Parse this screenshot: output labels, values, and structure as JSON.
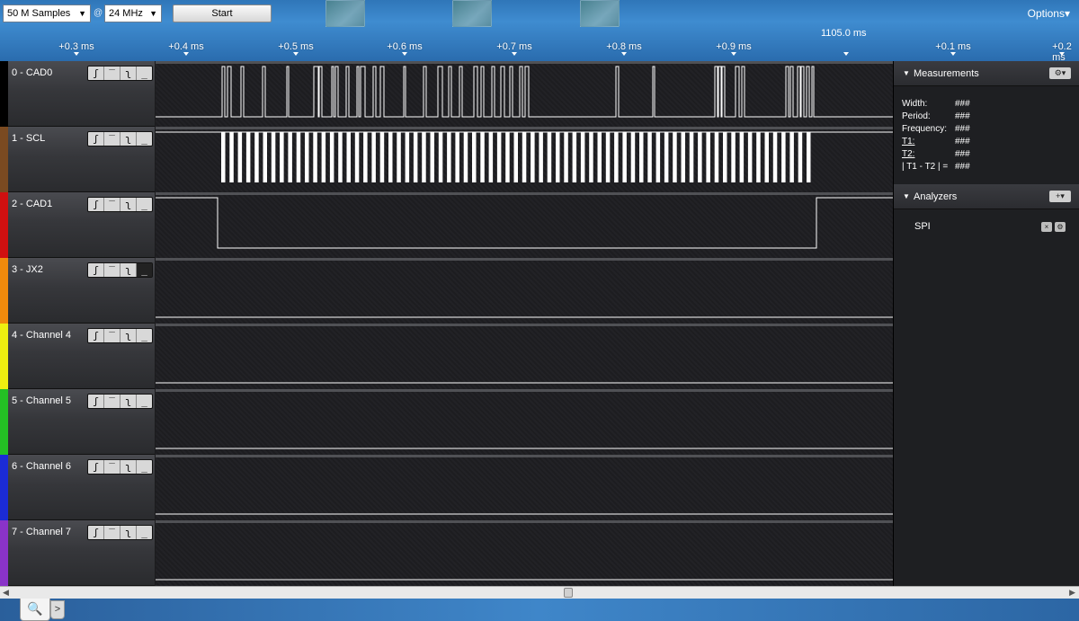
{
  "toolbar": {
    "samples_value": "50 M Samples",
    "at_sign": "@",
    "rate_value": "24 MHz",
    "start_label": "Start",
    "options_label": "Options▾"
  },
  "timeline": {
    "ticks": [
      "+0.3 ms",
      "+0.4 ms",
      "+0.5 ms",
      "+0.6 ms",
      "+0.7 ms",
      "+0.8 ms",
      "+0.9 ms",
      "+0.1 ms",
      "+0.2 ms"
    ],
    "cursor_time": "1105.0 ms"
  },
  "channels": [
    {
      "name": "0 - CAD0",
      "color": "#000000"
    },
    {
      "name": "1 - SCL",
      "color": "#7a4a21"
    },
    {
      "name": "2 - CAD1",
      "color": "#d01010"
    },
    {
      "name": "3 - JX2",
      "color": "#f08a0c"
    },
    {
      "name": "4 - Channel 4",
      "color": "#eeee10"
    },
    {
      "name": "5 - Channel 5",
      "color": "#24c024"
    },
    {
      "name": "6 - Channel 6",
      "color": "#1b2bd6"
    },
    {
      "name": "7 - Channel 7",
      "color": "#8a33c8"
    }
  ],
  "trigger_buttons": [
    "ʃ",
    "‾",
    "ʅ",
    "_"
  ],
  "measurements": {
    "title": "Measurements",
    "rows": [
      {
        "label": "Width:",
        "value": "###"
      },
      {
        "label": "Period:",
        "value": "###"
      },
      {
        "label": "Frequency:",
        "value": "###"
      },
      {
        "label": "T1:",
        "value": "###"
      },
      {
        "label": "T2:",
        "value": "###"
      },
      {
        "label": "| T1 - T2 | =",
        "value": "###"
      }
    ]
  },
  "analyzers": {
    "title": "Analyzers",
    "items": [
      "SPI"
    ]
  }
}
